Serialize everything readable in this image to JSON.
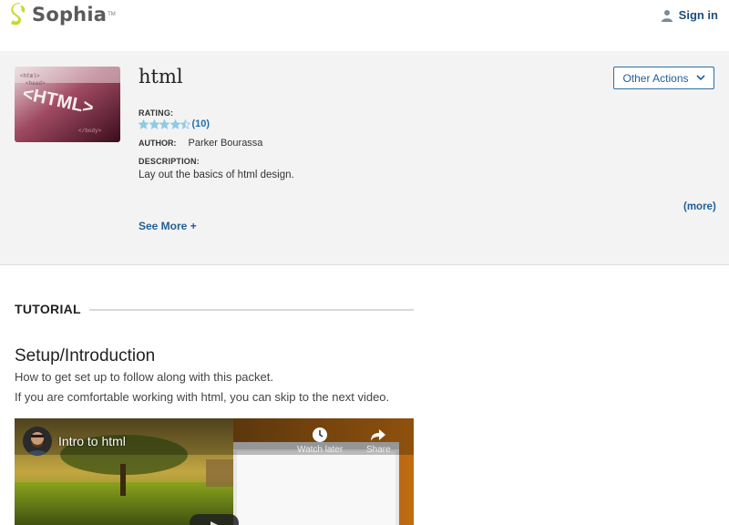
{
  "header": {
    "brand": "Sophia",
    "brand_mark": "TM",
    "signin_label": "Sign in",
    "signin_icon": "person-icon"
  },
  "resource": {
    "title": "html",
    "thumbnail_text": "<HTML>",
    "other_actions_label": "Other Actions",
    "rating_label": "RATING:",
    "rating_value": 4.5,
    "rating_count": "(10)",
    "author_label": "AUTHOR:",
    "author": "Parker Bourassa",
    "description_label": "DESCRIPTION:",
    "description": "Lay out the basics of html design.",
    "more_label": "(more)",
    "see_more_label": "See More +"
  },
  "tutorial": {
    "heading": "TUTORIAL",
    "section_title": "Setup/Introduction",
    "lines": [
      "How to get set up to follow along with this packet.",
      "If you are comfortable working with html, you can skip to the next video."
    ]
  },
  "video": {
    "title": "Intro to html",
    "watch_later_label": "Watch later",
    "share_label": "Share"
  },
  "colors": {
    "brand_green": "#c7d92c",
    "link_blue": "#1f5f99",
    "star_blue": "#8ecae6",
    "panel_bg": "#f3f3f3"
  }
}
